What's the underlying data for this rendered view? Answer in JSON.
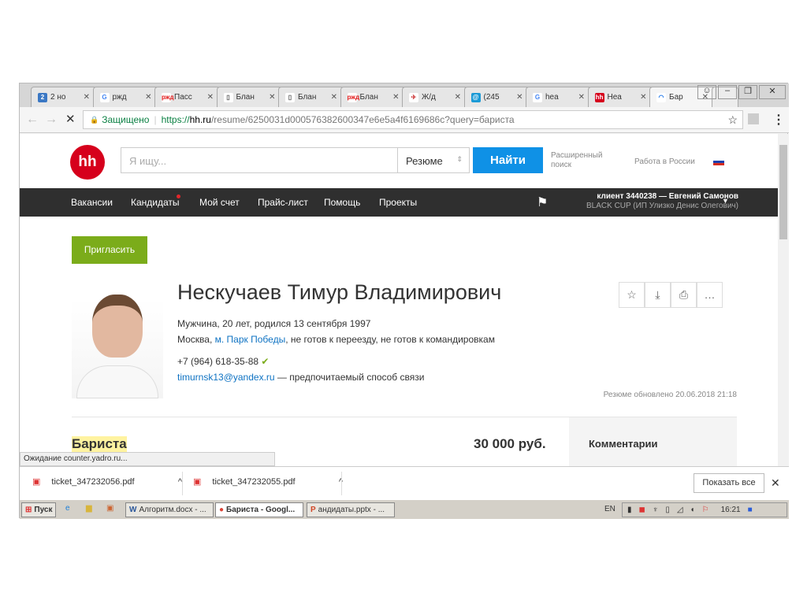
{
  "tabs": [
    {
      "label": "2 но",
      "icon": "2"
    },
    {
      "label": "ржд",
      "icon": "G"
    },
    {
      "label": "Пасс",
      "icon": "ржд"
    },
    {
      "label": "Блан",
      "icon": "doc"
    },
    {
      "label": "Блан",
      "icon": "doc"
    },
    {
      "label": "Блан",
      "icon": "ржд"
    },
    {
      "label": "Ж/д",
      "icon": "rail"
    },
    {
      "label": "(245",
      "icon": "mail"
    },
    {
      "label": "hea",
      "icon": "G"
    },
    {
      "label": "Hea",
      "icon": "hh"
    },
    {
      "label": "Бар",
      "icon": "loading"
    }
  ],
  "address": {
    "secure": "Защищено",
    "scheme": "https://",
    "host": "hh.ru",
    "path": "/resume/6250031d000576382600347e6e5a4f6169686c?query=бариста"
  },
  "header": {
    "logo": "hh",
    "search_placeholder": "Я ищу...",
    "select": "Резюме",
    "find": "Найти",
    "advanced": "Расширенный поиск",
    "work_russia": "Работа в России"
  },
  "nav": {
    "items": [
      "Вакансии",
      "Кандидаты",
      "Мой счет",
      "Прайс-лист",
      "Помощь",
      "Проекты"
    ],
    "client": "клиент 3440238 — Евгений Самонов",
    "company": "BLACK CUP (ИП Улизко Денис Олегович)"
  },
  "resume": {
    "invite": "Пригласить",
    "name": "Нескучаев Тимур Владимирович",
    "info": "Мужчина, 20 лет, родился 13 сентября 1997",
    "city": "Москва, ",
    "metro": "м. Парк Победы",
    "relocation": ", не готов к переезду, не готов к командировкам",
    "phone": "+7 (964) 618-35-88",
    "email": "timurnsk13@yandex.ru",
    "email_note": " — предпочитаемый способ связи",
    "updated": "Резюме обновлено 20.06.2018 21:18",
    "position": "Бариста",
    "salary": "30 000 руб.",
    "comments": "Комментарии"
  },
  "status": "Ожидание counter.yadro.ru...",
  "downloads": {
    "files": [
      "ticket_347232056.pdf",
      "ticket_347232055.pdf"
    ],
    "show_all": "Показать все"
  },
  "taskbar": {
    "start": "Пуск",
    "items": [
      "Алгоритм.docx - ...",
      "Бариста - Googl...",
      "андидаты.pptx - ..."
    ],
    "lang": "EN",
    "time": "16:21"
  }
}
